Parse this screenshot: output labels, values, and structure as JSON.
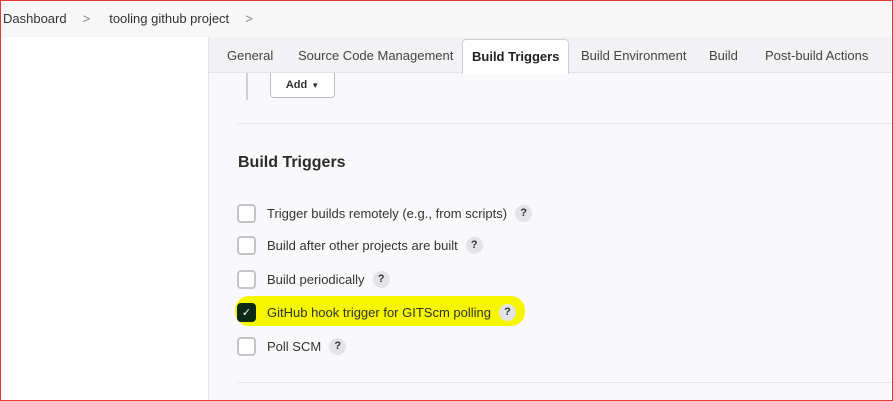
{
  "breadcrumb": {
    "items": [
      "Dashboard",
      "tooling github project"
    ],
    "separator": ">"
  },
  "tabs": [
    {
      "label": "General"
    },
    {
      "label": "Source Code Management"
    },
    {
      "label": "Build Triggers",
      "active": true
    },
    {
      "label": "Build Environment"
    },
    {
      "label": "Build"
    },
    {
      "label": "Post-build Actions"
    }
  ],
  "add_button": {
    "label": "Add",
    "icon": "caret-down-icon"
  },
  "section": {
    "title": "Build Triggers"
  },
  "triggers": [
    {
      "label": "Trigger builds remotely (e.g., from scripts)",
      "checked": false,
      "help": "?"
    },
    {
      "label": "Build after other projects are built",
      "checked": false,
      "help": "?"
    },
    {
      "label": "Build periodically",
      "checked": false,
      "help": "?"
    },
    {
      "label": "GitHub hook trigger for GITScm polling",
      "checked": true,
      "help": "?",
      "highlighted": true
    },
    {
      "label": "Poll SCM",
      "checked": false,
      "help": "?"
    }
  ],
  "colors": {
    "checked_fill": "#0b2a17",
    "highlight": "#f6f600"
  }
}
